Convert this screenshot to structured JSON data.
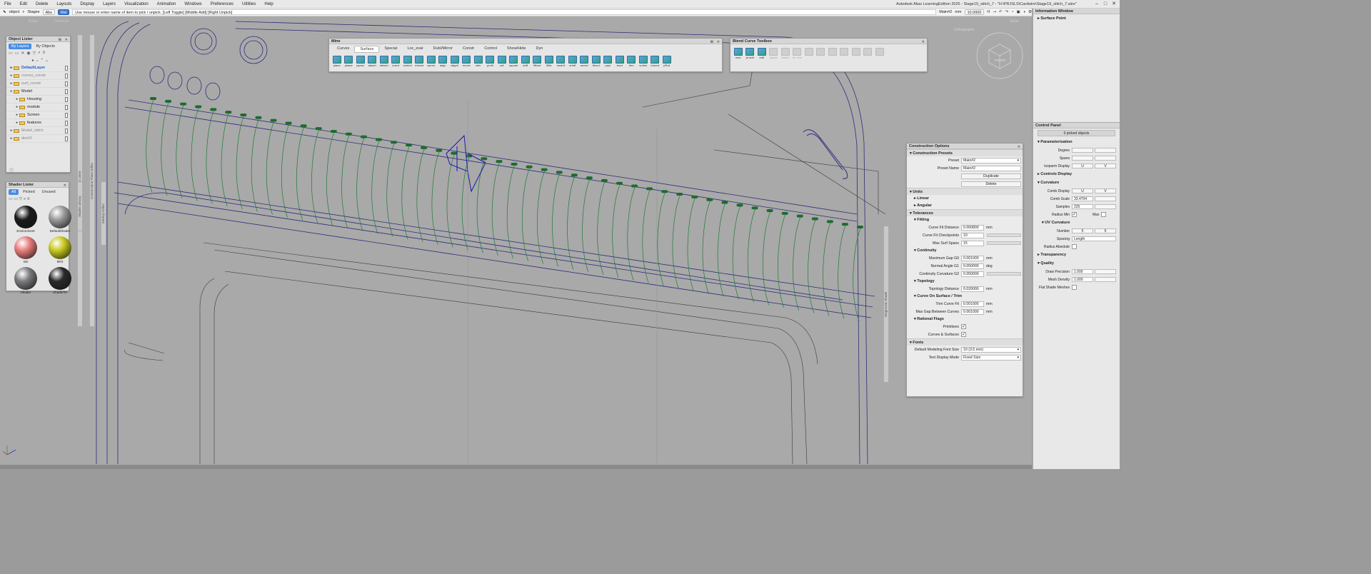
{
  "app": {
    "title": "Autodesk Alias LearningEdition 2025 - Stage19_stitch_7 - \"H:\\PRJSLS\\Cardwire\\Stage19_stitch_7.wire\"",
    "menu": [
      "File",
      "Edit",
      "Delete",
      "Layouts",
      "Display",
      "Layers",
      "Visualization",
      "Animation",
      "Windows",
      "Preferences",
      "Utilities",
      "Help"
    ]
  },
  "toolbar": {
    "pick_mode": "object",
    "stages": "Stages",
    "abs": "Abs",
    "rel": "Rel",
    "prompt": "Use mouse or enter name of item to pick / unpick. [Left Toggle] [Middle Add] [Right Unpick]",
    "view_name": "Main#2",
    "units": "mm",
    "tolerance": "10.0000",
    "ghost_left": "Rings",
    "ghost_right": "Cameras"
  },
  "object_lister": {
    "title": "Object Lister",
    "tabs": [
      "By Layers",
      "By Objects"
    ],
    "rows": [
      {
        "label": "DefaultLayer",
        "state": "sel",
        "depth": 0
      },
      {
        "label": "curves_constr",
        "state": "dim",
        "depth": 0
      },
      {
        "label": "surf_constr",
        "state": "dim",
        "depth": 0
      },
      {
        "label": "Model",
        "state": "normal",
        "depth": 0
      },
      {
        "label": "Housing",
        "state": "normal",
        "depth": 1
      },
      {
        "label": "module",
        "state": "normal",
        "depth": 1
      },
      {
        "label": "Screen",
        "state": "normal",
        "depth": 1
      },
      {
        "label": "features",
        "state": "normal",
        "depth": 1
      },
      {
        "label": "Model_stitch",
        "state": "dim",
        "depth": 0
      },
      {
        "label": "dim#2",
        "state": "dim",
        "depth": 0
      }
    ]
  },
  "shader_lister": {
    "title": "Shader Lister",
    "tabs": [
      "All",
      "Picked",
      "Unused"
    ],
    "shaders": [
      {
        "name": "Environment",
        "color": "#1b1b1b"
      },
      {
        "name": "DefaultShader",
        "color": "#9a9a9a"
      },
      {
        "name": "M2",
        "color": "#e87c7c"
      },
      {
        "name": "M#2",
        "color": "#c8c81e"
      },
      {
        "name": "Shader",
        "color": "#7a7a7e"
      },
      {
        "name": "Shader#2",
        "color": "#2a2a2a"
      }
    ]
  },
  "side_strips": [
    "Curves Lister",
    "Construction Plane Editor",
    "Shader Library",
    "Markup Editor",
    "Diagnostic Shade"
  ],
  "mine_shelf": {
    "title": "Mine",
    "tabs": [
      "Curves",
      "Surface",
      "Special",
      "Loc_eval",
      "DubI/Mirror",
      "Constr",
      "Control",
      "Show/Hide",
      "Dyn"
    ],
    "active_tab": "Surface",
    "tools": [
      "plane",
      "planar",
      "ptprec",
      "attach",
      "detach",
      "insert",
      "extend",
      "extend",
      "symm",
      "align",
      "align0",
      "revolv",
      "skin",
      "profil",
      "rail",
      "square",
      "srfill",
      "fftbnd",
      "fillfa",
      "msdrft",
      "srfoff",
      "accsrf",
      "ftmod",
      "prjct",
      "isect",
      "trim",
      "untrim",
      "trimcvt",
      "pRull"
    ]
  },
  "blend_toolbox": {
    "title": "Blend Curve Toolbox",
    "tools": [
      {
        "label": "new",
        "enabled": true
      },
      {
        "label": "pt add",
        "enabled": true
      },
      {
        "label": "edit",
        "enabled": true
      },
      {
        "label": "planar",
        "enabled": false
      },
      {
        "label": "attach",
        "enabled": false
      },
      {
        "label": "rm cnst",
        "enabled": false
      },
      {
        "label": "",
        "enabled": false
      },
      {
        "label": "",
        "enabled": false
      },
      {
        "label": "",
        "enabled": false
      },
      {
        "label": "",
        "enabled": false
      },
      {
        "label": "",
        "enabled": false
      },
      {
        "label": "",
        "enabled": false
      },
      {
        "label": "",
        "enabled": false
      }
    ]
  },
  "viewport": {
    "view_label": "Orthographic",
    "show_label": "Show",
    "cube_label": "FRONT"
  },
  "construction_options": {
    "title": "Construction Options",
    "sections": {
      "presets": "Construction Presets",
      "units": "Units",
      "linear": "Linear",
      "angular": "Angular",
      "tolerances": "Tolerances",
      "fitting": "Fitting",
      "continuity": "Continuity",
      "topology": "Topology",
      "cos": "Curve On Surface / Trim",
      "rational": "Rational Flags",
      "fonts": "Fonts"
    },
    "preset_label": "Preset",
    "preset_value": "Main#2",
    "preset_name_label": "Preset Name",
    "preset_name_value": "Main#2",
    "duplicate": "Duplicate",
    "delete": "Delete",
    "fields": {
      "curve_fit_distance": {
        "label": "Curve Fit Distance",
        "value": "0.000800",
        "unit": "mm"
      },
      "curve_fit_checkpoints": {
        "label": "Curve Fit Checkpoints",
        "value": "10",
        "unit": ""
      },
      "max_surf_spans": {
        "label": "Max Surf Spans",
        "value": "15",
        "unit": ""
      },
      "max_gap_g0": {
        "label": "Maximum Gap G0",
        "value": "0.001000",
        "unit": "mm"
      },
      "normal_angle_g1": {
        "label": "Normal Angle G1",
        "value": "0.050000",
        "unit": "deg"
      },
      "continuity_curvature_g2": {
        "label": "Continuity Curvature G2",
        "value": "0.050000",
        "unit": ""
      },
      "topology_distance": {
        "label": "Topology Distance",
        "value": "0.020000",
        "unit": "mm"
      },
      "trim_curve_fit": {
        "label": "Trim Curve Fit",
        "value": "0.001000",
        "unit": "mm"
      },
      "max_gap_between_curves": {
        "label": "Max Gap Between Curves",
        "value": "0.001000",
        "unit": "mm"
      }
    },
    "primitives_label": "Primitives",
    "curves_surfaces_label": "Curves & Surfaces",
    "font_size_label": "Default Modeling Font Size",
    "font_size_value": "10 (3.5 mm)",
    "text_mode_label": "Text Display Mode",
    "text_mode_value": "Fixed Size"
  },
  "info_window": {
    "title": "Information Window",
    "section": "Surface Point"
  },
  "control_panel": {
    "title": "Control Panel",
    "picked": "0 picked objects",
    "parameterization": "Parameterization",
    "degree": "Degree",
    "spans": "Spans",
    "isoparm_display": "Isoparm Display",
    "u": "U",
    "v": "V",
    "controls_display": "Controls Display",
    "curvature": "Curvature",
    "comb_display": "Comb Display",
    "comb_scale_label": "Comb Scale",
    "comb_scale_value": "33.4704",
    "samples_label": "Samples",
    "samples_value": "225",
    "radius_min": "Radius Min",
    "max": "Max",
    "uv_curvature": "UV Curvature",
    "number_label": "Number",
    "number_u": "5",
    "number_v": "5",
    "spacing_label": "Spacing",
    "spacing_value": "Length",
    "radius_absolute": "Radius Absolute",
    "transparency": "Transparency",
    "quality": "Quality",
    "draw_precision_label": "Draw Precision",
    "draw_precision_value": "1.000",
    "mesh_density_label": "Mesh Density",
    "mesh_density_value": "1.000",
    "flat_shade": "Flat Shade Meshes"
  }
}
